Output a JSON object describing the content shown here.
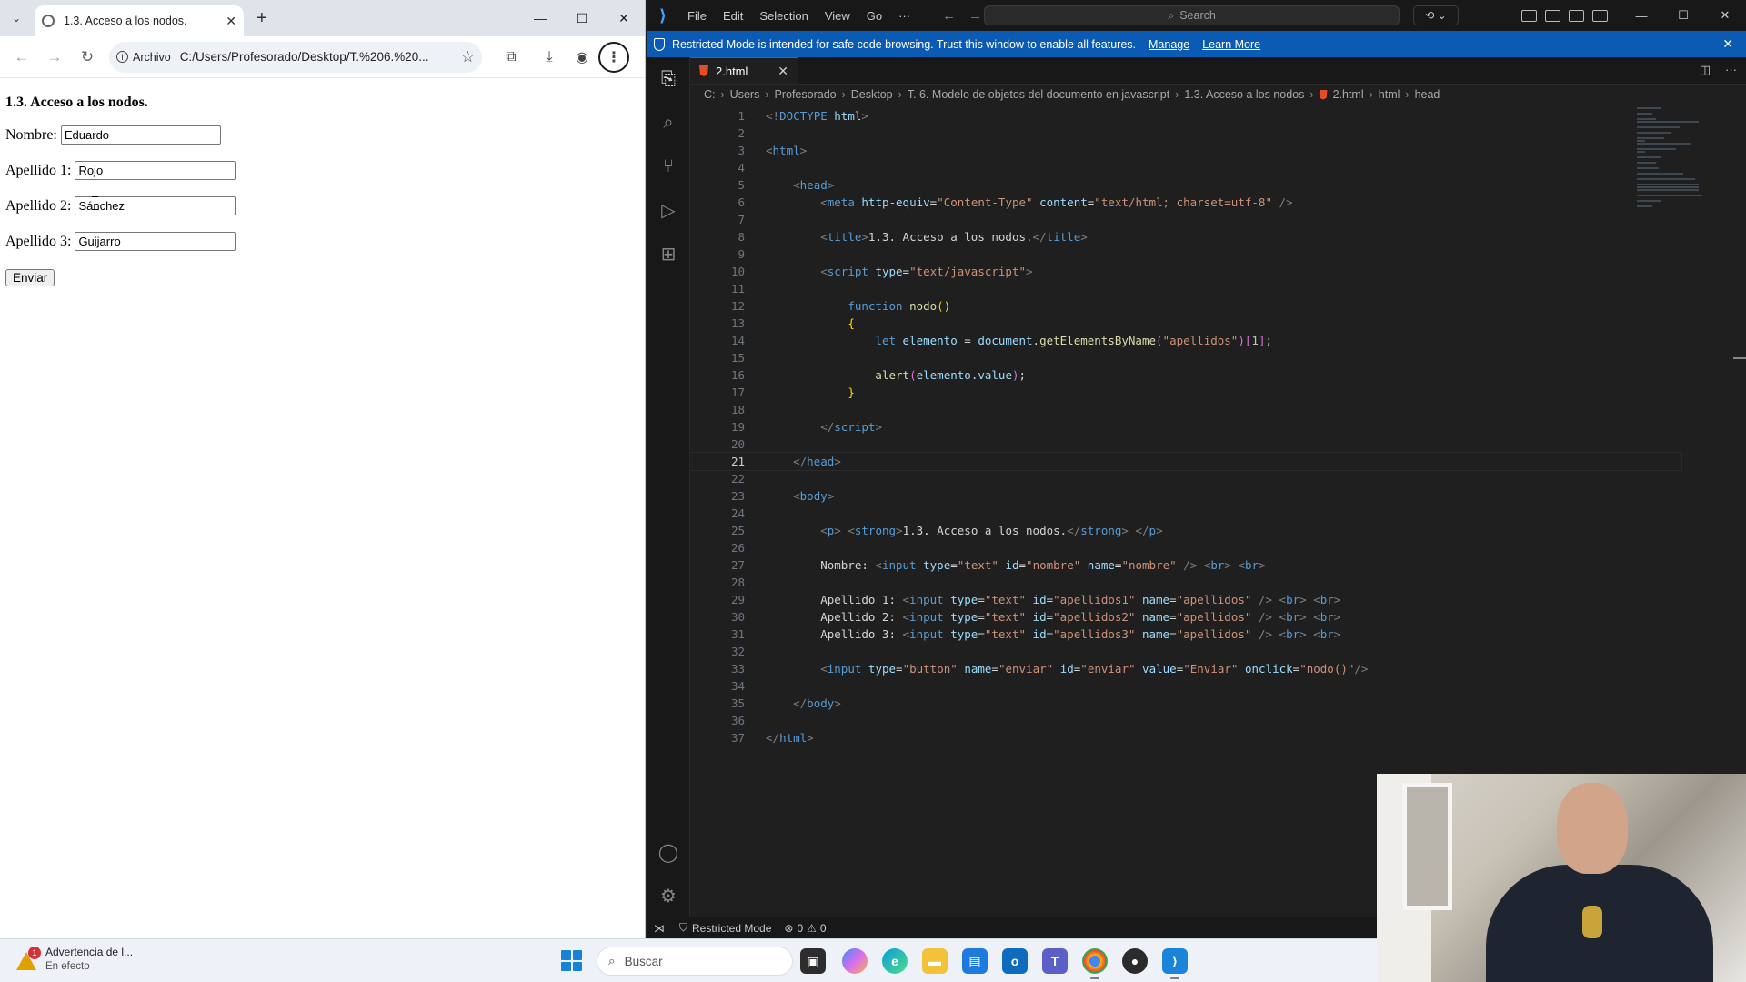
{
  "browser": {
    "tab_title": "1.3. Acceso a los nodos.",
    "info_chip": "Archivo",
    "url": "C:/Users/Profesorado/Desktop/T.%206.%20...",
    "page": {
      "heading": "1.3. Acceso a los nodos.",
      "fields": [
        {
          "label": "Nombre:",
          "value": "Eduardo"
        },
        {
          "label": "Apellido 1:",
          "value": "Rojo"
        },
        {
          "label": "Apellido 2:",
          "value": "Sánchez"
        },
        {
          "label": "Apellido 3:",
          "value": "Guijarro"
        }
      ],
      "button_label": "Enviar"
    }
  },
  "vscode": {
    "menu": [
      "File",
      "Edit",
      "Selection",
      "View",
      "Go",
      "···"
    ],
    "search_placeholder": "Search",
    "banner": {
      "message": "Restricted Mode is intended for safe code browsing. Trust this window to enable all features.",
      "manage": "Manage",
      "learn_more": "Learn More"
    },
    "tab": {
      "filename": "2.html"
    },
    "breadcrumb": [
      "C:",
      "Users",
      "Profesorado",
      "Desktop",
      "T. 6. Modelo de objetos del documento en javascript",
      "1.3. Acceso a los nodos",
      "2.html",
      "html",
      "head"
    ],
    "current_line": 21,
    "status": {
      "mode": "Restricted Mode",
      "errors": "0",
      "warnings": "0"
    }
  },
  "taskbar": {
    "notification_title": "Advertencia de l...",
    "notification_sub": "En efecto",
    "notification_badge": "1",
    "search_placeholder": "Buscar"
  },
  "colors": {
    "vscode_bg": "#1f1f1f",
    "banner_blue": "#0b5bb5",
    "accent": "#0078d4",
    "html_orange": "#e44d26"
  }
}
